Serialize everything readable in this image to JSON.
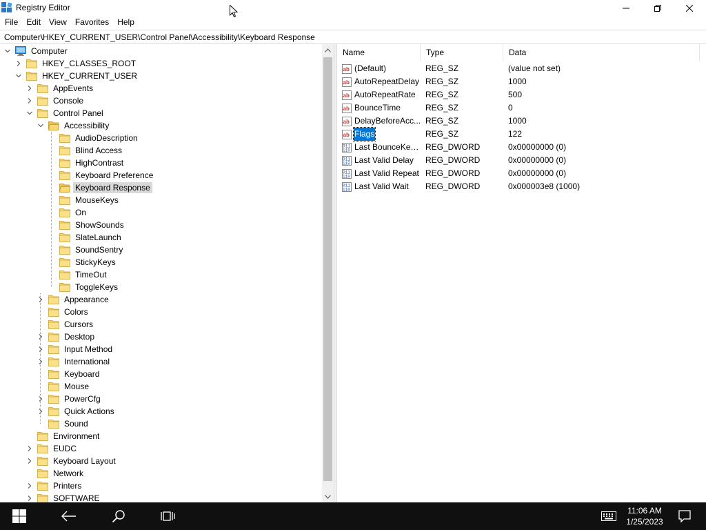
{
  "window": {
    "title": "Registry Editor",
    "icon": "registry-editor-icon",
    "controls": [
      "minimize-icon",
      "restore-icon",
      "close-icon"
    ]
  },
  "menu": [
    "File",
    "Edit",
    "View",
    "Favorites",
    "Help"
  ],
  "address": "Computer\\HKEY_CURRENT_USER\\Control Panel\\Accessibility\\Keyboard Response",
  "tree": {
    "items": [
      {
        "label": "Computer",
        "level": 0,
        "expander": "expanded",
        "icon": "computer-icon"
      },
      {
        "label": "HKEY_CLASSES_ROOT",
        "level": 1,
        "expander": "collapsed",
        "icon": "folder-icon"
      },
      {
        "label": "HKEY_CURRENT_USER",
        "level": 1,
        "expander": "expanded",
        "icon": "folder-icon"
      },
      {
        "label": "AppEvents",
        "level": 2,
        "expander": "collapsed",
        "icon": "folder-icon"
      },
      {
        "label": "Console",
        "level": 2,
        "expander": "collapsed",
        "icon": "folder-icon"
      },
      {
        "label": "Control Panel",
        "level": 2,
        "expander": "expanded",
        "icon": "folder-icon"
      },
      {
        "label": "Accessibility",
        "level": 3,
        "expander": "expanded",
        "icon": "folder-open-icon"
      },
      {
        "label": "AudioDescription",
        "level": 4,
        "expander": "none",
        "icon": "folder-icon"
      },
      {
        "label": "Blind Access",
        "level": 4,
        "expander": "none",
        "icon": "folder-icon"
      },
      {
        "label": "HighContrast",
        "level": 4,
        "expander": "none",
        "icon": "folder-icon"
      },
      {
        "label": "Keyboard Preference",
        "level": 4,
        "expander": "none",
        "icon": "folder-icon"
      },
      {
        "label": "Keyboard Response",
        "level": 4,
        "expander": "none",
        "icon": "folder-open-icon",
        "selected": true
      },
      {
        "label": "MouseKeys",
        "level": 4,
        "expander": "none",
        "icon": "folder-icon"
      },
      {
        "label": "On",
        "level": 4,
        "expander": "none",
        "icon": "folder-icon"
      },
      {
        "label": "ShowSounds",
        "level": 4,
        "expander": "none",
        "icon": "folder-icon"
      },
      {
        "label": "SlateLaunch",
        "level": 4,
        "expander": "none",
        "icon": "folder-icon"
      },
      {
        "label": "SoundSentry",
        "level": 4,
        "expander": "none",
        "icon": "folder-icon"
      },
      {
        "label": "StickyKeys",
        "level": 4,
        "expander": "none",
        "icon": "folder-icon"
      },
      {
        "label": "TimeOut",
        "level": 4,
        "expander": "none",
        "icon": "folder-icon"
      },
      {
        "label": "ToggleKeys",
        "level": 4,
        "expander": "none",
        "icon": "folder-icon"
      },
      {
        "label": "Appearance",
        "level": 3,
        "expander": "collapsed",
        "icon": "folder-icon"
      },
      {
        "label": "Colors",
        "level": 3,
        "expander": "none",
        "icon": "folder-icon"
      },
      {
        "label": "Cursors",
        "level": 3,
        "expander": "none",
        "icon": "folder-icon"
      },
      {
        "label": "Desktop",
        "level": 3,
        "expander": "collapsed",
        "icon": "folder-icon"
      },
      {
        "label": "Input Method",
        "level": 3,
        "expander": "collapsed",
        "icon": "folder-icon"
      },
      {
        "label": "International",
        "level": 3,
        "expander": "collapsed",
        "icon": "folder-icon"
      },
      {
        "label": "Keyboard",
        "level": 3,
        "expander": "none",
        "icon": "folder-icon"
      },
      {
        "label": "Mouse",
        "level": 3,
        "expander": "none",
        "icon": "folder-icon"
      },
      {
        "label": "PowerCfg",
        "level": 3,
        "expander": "collapsed",
        "icon": "folder-icon"
      },
      {
        "label": "Quick Actions",
        "level": 3,
        "expander": "collapsed",
        "icon": "folder-icon"
      },
      {
        "label": "Sound",
        "level": 3,
        "expander": "none",
        "icon": "folder-icon"
      },
      {
        "label": "Environment",
        "level": 2,
        "expander": "none",
        "icon": "folder-icon"
      },
      {
        "label": "EUDC",
        "level": 2,
        "expander": "collapsed",
        "icon": "folder-icon"
      },
      {
        "label": "Keyboard Layout",
        "level": 2,
        "expander": "collapsed",
        "icon": "folder-icon"
      },
      {
        "label": "Network",
        "level": 2,
        "expander": "none",
        "icon": "folder-icon"
      },
      {
        "label": "Printers",
        "level": 2,
        "expander": "collapsed",
        "icon": "folder-icon"
      },
      {
        "label": "SOFTWARE",
        "level": 2,
        "expander": "collapsed",
        "icon": "folder-icon"
      }
    ]
  },
  "list": {
    "columns": [
      "Name",
      "Type",
      "Data"
    ],
    "rows": [
      {
        "name": "(Default)",
        "type": "REG_SZ",
        "data": "(value not set)",
        "icon": "string-value-icon"
      },
      {
        "name": "AutoRepeatDelay",
        "type": "REG_SZ",
        "data": "1000",
        "icon": "string-value-icon"
      },
      {
        "name": "AutoRepeatRate",
        "type": "REG_SZ",
        "data": "500",
        "icon": "string-value-icon"
      },
      {
        "name": "BounceTime",
        "type": "REG_SZ",
        "data": "0",
        "icon": "string-value-icon"
      },
      {
        "name": "DelayBeforeAcc...",
        "type": "REG_SZ",
        "data": "1000",
        "icon": "string-value-icon"
      },
      {
        "name": "Flags",
        "type": "REG_SZ",
        "data": "122",
        "icon": "string-value-icon",
        "selected": true
      },
      {
        "name": "Last BounceKey ...",
        "type": "REG_DWORD",
        "data": "0x00000000 (0)",
        "icon": "binary-value-icon"
      },
      {
        "name": "Last Valid Delay",
        "type": "REG_DWORD",
        "data": "0x00000000 (0)",
        "icon": "binary-value-icon"
      },
      {
        "name": "Last Valid Repeat",
        "type": "REG_DWORD",
        "data": "0x00000000 (0)",
        "icon": "binary-value-icon"
      },
      {
        "name": "Last Valid Wait",
        "type": "REG_DWORD",
        "data": "0x000003e8 (1000)",
        "icon": "binary-value-icon"
      }
    ]
  },
  "taskbar": {
    "time": "11:06 AM",
    "date": "1/25/2023",
    "buttons": [
      "windows-start-icon",
      "back-arrow-icon",
      "search-icon",
      "task-view-icon"
    ],
    "tray": [
      "touch-keyboard-icon",
      "notifications-icon"
    ]
  },
  "colors": {
    "selection_blue": "#0078d7",
    "tree_selection": "#d9d9d9",
    "taskbar_bg": "#101010",
    "folder_yellow": "#f8d775"
  }
}
